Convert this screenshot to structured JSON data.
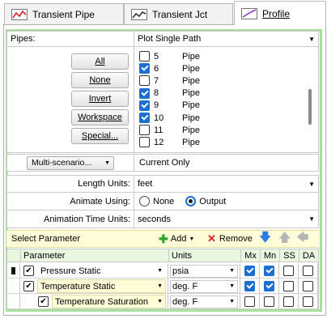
{
  "tabs": [
    {
      "label": "Transient Pipe",
      "icon": "pipe-graph-icon"
    },
    {
      "label": "Transient Jct",
      "icon": "junction-graph-icon"
    },
    {
      "label": "Profile",
      "icon": "profile-graph-icon"
    }
  ],
  "pipes_label": "Pipes:",
  "pipes_mode": "Plot Single Path",
  "buttons": {
    "all": "All",
    "none": "None",
    "invert": "Invert",
    "workspace": "Workspace",
    "special": "Special..."
  },
  "pipe_list": [
    {
      "num": "5",
      "type": "Pipe",
      "checked": false
    },
    {
      "num": "6",
      "type": "Pipe",
      "checked": true
    },
    {
      "num": "7",
      "type": "Pipe",
      "checked": false
    },
    {
      "num": "8",
      "type": "Pipe",
      "checked": true
    },
    {
      "num": "9",
      "type": "Pipe",
      "checked": true
    },
    {
      "num": "10",
      "type": "Pipe",
      "checked": true
    },
    {
      "num": "11",
      "type": "Pipe",
      "checked": false
    },
    {
      "num": "12",
      "type": "Pipe",
      "checked": false
    }
  ],
  "scenario_button": "Multi-scenario...",
  "scenario_value": "Current Only",
  "length_units_label": "Length Units:",
  "length_units": "feet",
  "animate_label": "Animate Using:",
  "animate_none": "None",
  "animate_output": "Output",
  "animate_selected": "Output",
  "anim_time_label": "Animation Time Units:",
  "anim_time_units": "seconds",
  "select_param_label": "Select Parameter",
  "add_label": "Add",
  "remove_label": "Remove",
  "param_table": {
    "headers": [
      "Parameter",
      "Units",
      "Mx",
      "Mn",
      "SS",
      "DA"
    ],
    "rows": [
      {
        "name": "Pressure Static",
        "units": "psia",
        "mx": true,
        "mn": true,
        "ss": false,
        "da": false
      },
      {
        "name": "Temperature Static",
        "units": "deg. F",
        "mx": true,
        "mn": true,
        "ss": false,
        "da": false
      },
      {
        "name": "Temperature Saturation",
        "units": "deg. F",
        "mx": false,
        "mn": false,
        "ss": false,
        "da": false
      }
    ]
  },
  "colors": {
    "accent": "#1a6fd1",
    "frame_green": "#a9df9e",
    "row_yellow": "#fffcd8",
    "header_green": "#eaf7e0"
  }
}
